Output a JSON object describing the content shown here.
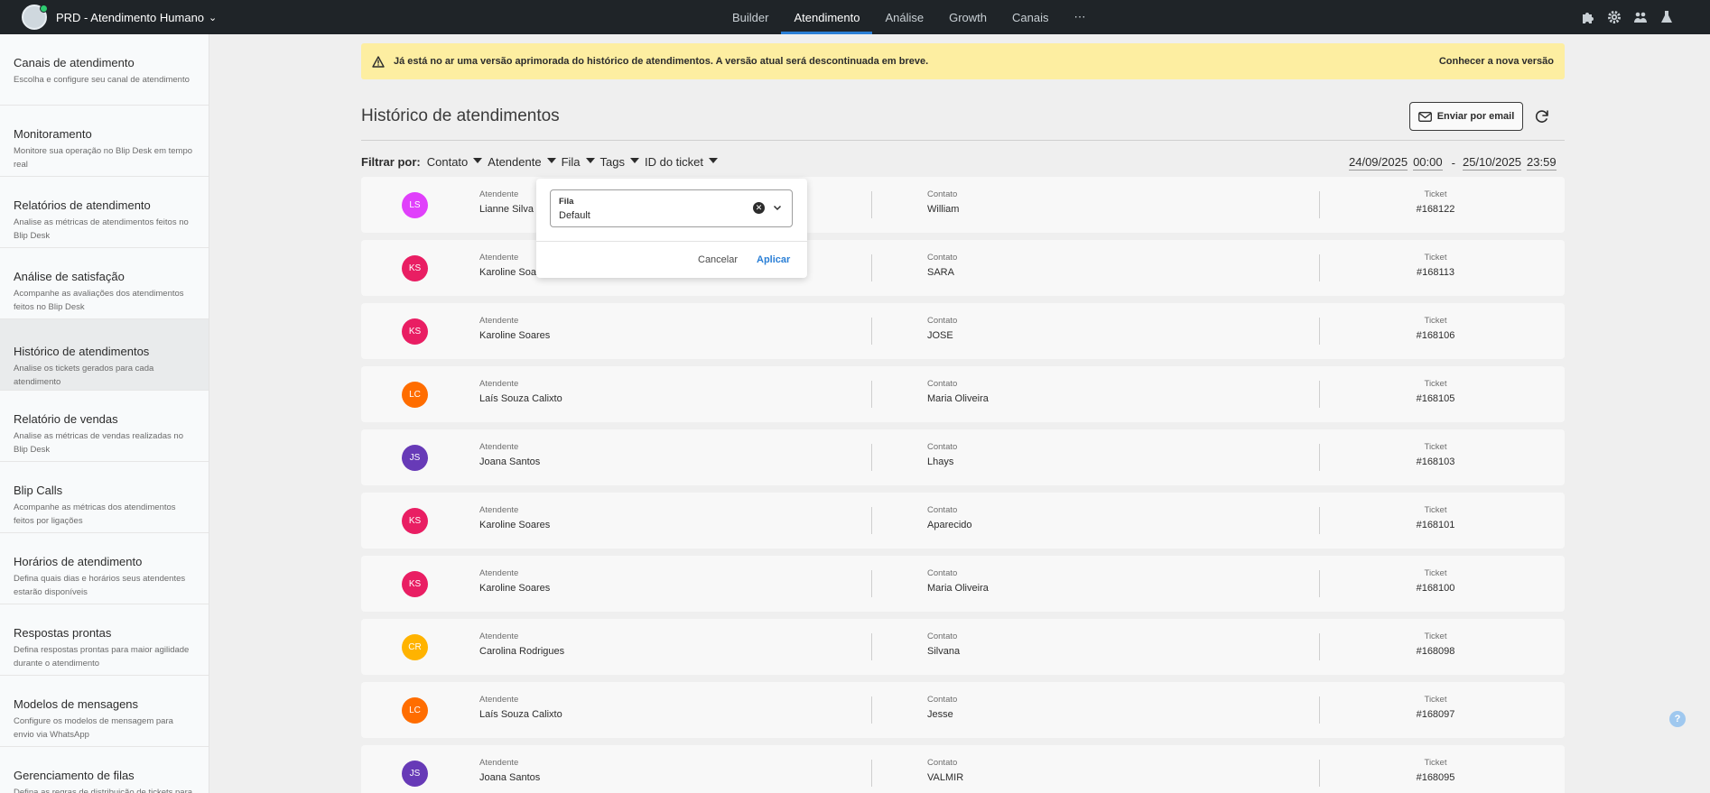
{
  "topbar": {
    "bot_name": "PRD - Atendimento Humano",
    "nav": [
      "Builder",
      "Atendimento",
      "Análise",
      "Growth",
      "Canais",
      "⋯"
    ],
    "active_nav": "Atendimento",
    "icons": [
      "puzzle-icon",
      "gear-icon",
      "team-icon",
      "flask-icon"
    ]
  },
  "sidebar": {
    "items": [
      {
        "title": "Canais de atendimento",
        "desc": "Escolha e configure seu canal de atendimento"
      },
      {
        "title": "Monitoramento",
        "desc": "Monitore sua operação no Blip Desk em tempo real"
      },
      {
        "title": "Relatórios de atendimento",
        "desc": "Analise as métricas de atendimentos feitos no Blip Desk"
      },
      {
        "title": "Análise de satisfação",
        "desc": "Acompanhe as avaliações dos atendimentos feitos no Blip Desk"
      },
      {
        "title": "Histórico de atendimentos",
        "desc": "Analise os tickets gerados para cada atendimento"
      },
      {
        "title": "Relatório de vendas",
        "desc": "Analise as métricas de vendas realizadas no Blip Desk"
      },
      {
        "title": "Blip Calls",
        "desc": "Acompanhe as métricas dos atendimentos feitos por ligações"
      },
      {
        "title": "Horários de atendimento",
        "desc": "Defina quais dias e horários seus atendentes estarão disponíveis"
      },
      {
        "title": "Respostas prontas",
        "desc": "Defina respostas prontas para maior agilidade durante o atendimento"
      },
      {
        "title": "Modelos de mensagens",
        "desc": "Configure os modelos de mensagem para envio via WhatsApp"
      },
      {
        "title": "Gerenciamento de filas",
        "desc": "Defina as regras de distribuição de tickets para"
      }
    ],
    "active_index": 4
  },
  "banner": {
    "text": "Já está no ar uma versão aprimorada do histórico de atendimentos. A versão atual será descontinuada em breve.",
    "link": "Conhecer a nova versão"
  },
  "main": {
    "title": "Histórico de atendimentos",
    "email_button": "Enviar por email"
  },
  "filters": {
    "label": "Filtrar por:",
    "items": [
      "Contato",
      "Atendente",
      "Fila",
      "Tags",
      "ID do ticket"
    ],
    "date_from": "24/09/2025",
    "time_from": "00:00",
    "sep": "-",
    "date_to": "25/10/2025",
    "time_to": "23:59"
  },
  "columns": {
    "agent": "Atendente",
    "contact": "Contato",
    "ticket": "Ticket"
  },
  "rows": [
    {
      "initials": "LS",
      "color": "#e040fb",
      "agent": "Lianne Silva",
      "contact": "William",
      "ticket": "#168122"
    },
    {
      "initials": "KS",
      "color": "#e91e63",
      "agent": "Karoline Soares",
      "contact": "SARA",
      "ticket": "#168113"
    },
    {
      "initials": "KS",
      "color": "#e91e63",
      "agent": "Karoline Soares",
      "contact": "JOSE",
      "ticket": "#168106"
    },
    {
      "initials": "LC",
      "color": "#ff6d00",
      "agent": "Laís Souza Calixto",
      "contact": "Maria Oliveira",
      "ticket": "#168105"
    },
    {
      "initials": "JS",
      "color": "#673ab7",
      "agent": "Joana Santos",
      "contact": "Lhays",
      "ticket": "#168103"
    },
    {
      "initials": "KS",
      "color": "#e91e63",
      "agent": "Karoline Soares",
      "contact": "Aparecido",
      "ticket": "#168101"
    },
    {
      "initials": "KS",
      "color": "#e91e63",
      "agent": "Karoline Soares",
      "contact": "Maria Oliveira",
      "ticket": "#168100"
    },
    {
      "initials": "CR",
      "color": "#ffb300",
      "agent": "Carolina Rodrigues",
      "contact": "Silvana",
      "ticket": "#168098"
    },
    {
      "initials": "LC",
      "color": "#ff6d00",
      "agent": "Laís Souza Calixto",
      "contact": "Jesse",
      "ticket": "#168097"
    },
    {
      "initials": "JS",
      "color": "#673ab7",
      "agent": "Joana Santos",
      "contact": "VALMIR",
      "ticket": "#168095"
    }
  ],
  "popover": {
    "field_label": "Fila",
    "field_value": "Default",
    "cancel": "Cancelar",
    "apply": "Aplicar"
  },
  "help": {
    "label": "?"
  }
}
